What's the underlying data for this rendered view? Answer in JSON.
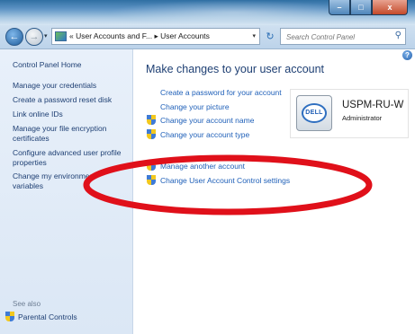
{
  "window": {
    "minimize_glyph": "–",
    "maximize_glyph": "□",
    "close_glyph": "x"
  },
  "nav": {
    "breadcrumb": "« User Accounts and F... ▸ User Accounts",
    "address_dropdown_glyph": "▾",
    "refresh_glyph": "↻",
    "search_placeholder": "Search Control Panel",
    "search_icon": "magnifier-icon"
  },
  "help_glyph": "?",
  "sidebar": {
    "home": "Control Panel Home",
    "links": [
      "Manage your credentials",
      "Create a password reset disk",
      "Link online IDs",
      "Manage your file encryption certificates",
      "Configure advanced user profile properties",
      "Change my environment variables"
    ],
    "see_also": "See also",
    "parental": "Parental Controls"
  },
  "main": {
    "title": "Make changes to your user account",
    "tasks": [
      {
        "label": "Create a password for your account",
        "shield": false
      },
      {
        "label": "Change your picture",
        "shield": false
      },
      {
        "label": "Change your account name",
        "shield": true
      },
      {
        "label": "Change your account type",
        "shield": true
      }
    ],
    "tasks2": [
      {
        "label": "Manage another account",
        "shield": true
      },
      {
        "label": "Change User Account Control settings",
        "shield": true
      }
    ]
  },
  "account": {
    "name": "USPM-RU-W",
    "role": "Administrator",
    "logo_text": "DELL"
  },
  "colors": {
    "link": "#1e5fb8",
    "sidebar_link": "#1e3f73",
    "annotation": "#e0101a"
  }
}
